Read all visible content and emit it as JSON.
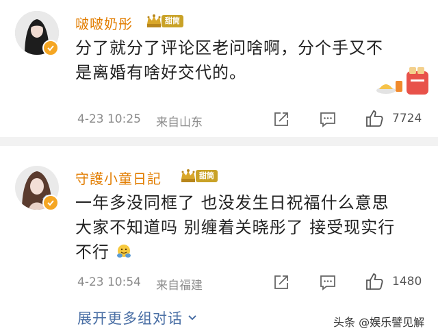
{
  "comments": [
    {
      "username": "啵啵奶彤",
      "badge": "甜筒",
      "text_line1": "分了就分了评论区老问啥啊，分个手又不",
      "text_line2": "是离婚有啥好交代的。",
      "timestamp": "4-23 10:25",
      "location": "来自山东",
      "likes": "7724"
    },
    {
      "username": "守護小童日記",
      "badge": "甜筒",
      "text_line1": "一年多没同框了 也没发生日祝福什么意思",
      "text_line2": "大家不知道吗 别缠着关晓彤了 接受现实行",
      "text_line3": "不行",
      "timestamp": "4-23 10:54",
      "location": "来自福建",
      "likes": "1480",
      "expand_label": "展开更多组对话",
      "watermark": "头条 @娱乐譬见解"
    }
  ],
  "colors": {
    "username": "#e27d00",
    "badge": "#c9a227",
    "link": "#4a6fa5",
    "meta": "#8c8c8c",
    "divider": "#f2f2f2"
  }
}
